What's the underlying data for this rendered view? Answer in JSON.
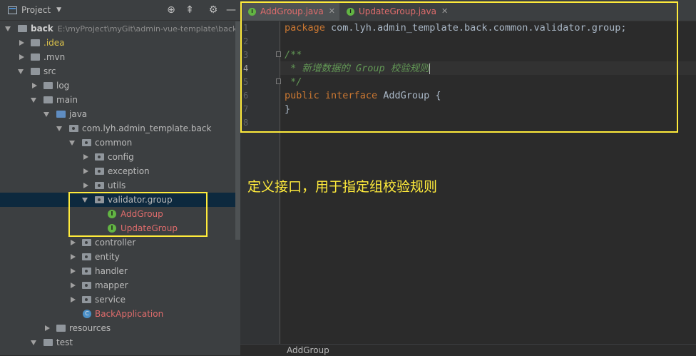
{
  "project_panel": {
    "title": "Project",
    "tree": [
      {
        "label": "back",
        "path": "E:\\myProject\\myGit\\admin-vue-template\\back"
      },
      {
        "label": ".idea"
      },
      {
        "label": ".mvn"
      },
      {
        "label": "src"
      },
      {
        "label": "log"
      },
      {
        "label": "main"
      },
      {
        "label": "java"
      },
      {
        "label": "com.lyh.admin_template.back"
      },
      {
        "label": "common"
      },
      {
        "label": "config"
      },
      {
        "label": "exception"
      },
      {
        "label": "utils"
      },
      {
        "label": "validator.group"
      },
      {
        "label": "AddGroup"
      },
      {
        "label": "UpdateGroup"
      },
      {
        "label": "controller"
      },
      {
        "label": "entity"
      },
      {
        "label": "handler"
      },
      {
        "label": "mapper"
      },
      {
        "label": "service"
      },
      {
        "label": "BackApplication"
      },
      {
        "label": "resources"
      },
      {
        "label": "test"
      }
    ]
  },
  "editor": {
    "tabs": [
      {
        "label": "AddGroup.java",
        "active": true
      },
      {
        "label": "UpdateGroup.java",
        "active": false
      }
    ],
    "line_numbers": [
      "1",
      "2",
      "3",
      "4",
      "5",
      "6",
      "7",
      "8"
    ],
    "code": {
      "l1_kw": "package",
      "l1_rest": " com.lyh.admin_template.back.common.validator.group;",
      "l3": "/**",
      "l4": " * 新增数据的 Group 校验规则",
      "l5": " */",
      "l6_kw1": "public",
      "l6_kw2": "interface",
      "l6_rest": " AddGroup {",
      "l7": "}"
    },
    "annotation": "定义接口，用于指定组校验规则",
    "breadcrumb": "AddGroup"
  },
  "colors": {
    "highlight_box": "#ffeb3b",
    "keyword": "#cc7832",
    "comment": "#629755",
    "modified_file": "#e06c6c"
  }
}
